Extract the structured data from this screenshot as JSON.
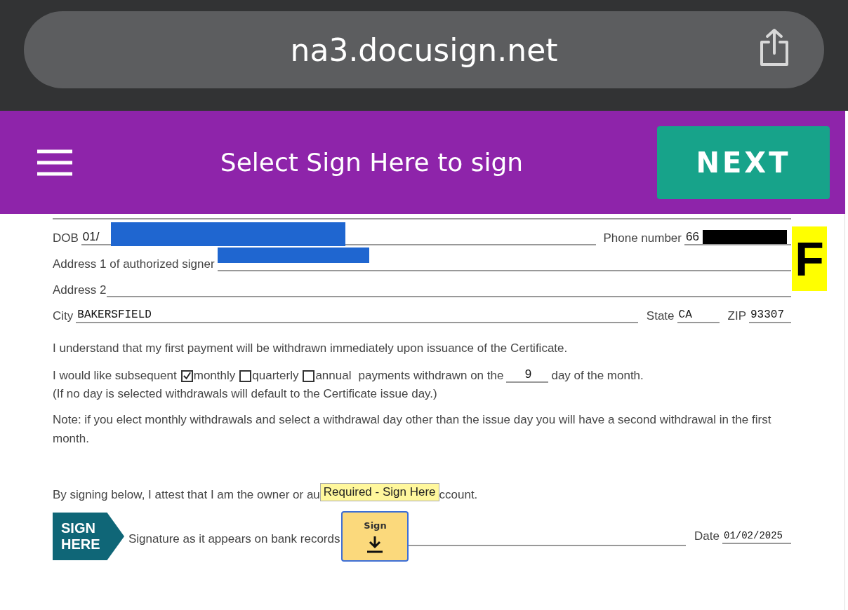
{
  "browser": {
    "url": "na3.docusign.net"
  },
  "header": {
    "title": "Select Sign Here to sign",
    "next_button": "NEXT"
  },
  "badge": "F",
  "form": {
    "dob": {
      "label": "DOB",
      "value": "01/"
    },
    "phone": {
      "label": "Phone number",
      "value": "66"
    },
    "address1": {
      "label": "Address 1 of authorized signer"
    },
    "address2": {
      "label": "Address 2"
    },
    "city": {
      "label": "City",
      "value": "BAKERSFIELD"
    },
    "state": {
      "label": "State",
      "value": "CA"
    },
    "zip": {
      "label": "ZIP",
      "value": "93307"
    },
    "first_payment": "I understand that my first payment will be withdrawn immediately upon issuance of the Certificate.",
    "frequency": {
      "lead": "I would like subsequent",
      "options": [
        {
          "label": "monthly",
          "checked": true
        },
        {
          "label": "quarterly",
          "checked": false
        },
        {
          "label": "annual",
          "checked": false
        }
      ],
      "middle": "payments withdrawn on the",
      "day": "9",
      "tail": "day of the month."
    },
    "default_note": "(If no day is selected withdrawals will default to the Certificate issue day.)",
    "note": "Note: if you elect monthly withdrawals and select a withdrawal day other than the issue day you will have a second withdrawal in the first month.",
    "attest_start": "By signing below, I attest that I am the owner or au",
    "attest_end": "ccount.",
    "tooltip": "Required - Sign Here",
    "sign_tag": [
      "SIGN",
      "HERE"
    ],
    "signature_label": "Signature as it appears on bank records",
    "sign_button": "Sign",
    "date": {
      "label": "Date",
      "value": "01/02/2025"
    }
  }
}
